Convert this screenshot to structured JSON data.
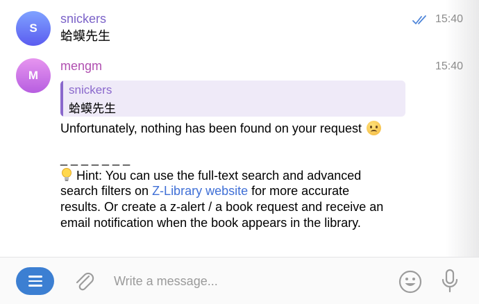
{
  "messages": [
    {
      "avatar_letter": "S",
      "sender": "snickers",
      "time": "15:40",
      "text": "蛤蟆先生"
    },
    {
      "avatar_letter": "M",
      "sender": "mengm",
      "time": "15:40",
      "reply": {
        "sender": "snickers",
        "text": "蛤蟆先生"
      },
      "line1": "Unfortunately, nothing has been found on your request",
      "separator": "_ _ _ _ _ _ _",
      "hint_line1": " Hint: You can use the full-text search and advanced",
      "hint_line2_pre": "search filters on ",
      "hint_link": "Z-Library website",
      "hint_line2_post": " for more accurate",
      "hint_line3": "results. Or create a z-alert / a book request and receive an",
      "hint_line4": "email notification when the book appears in the library."
    }
  ],
  "composer": {
    "placeholder": "Write a message..."
  },
  "icons": {
    "read_status": "double-check-icon",
    "attach": "paperclip-icon",
    "emoji": "smiley-icon",
    "voice": "microphone-icon",
    "menu": "menu-icon"
  }
}
